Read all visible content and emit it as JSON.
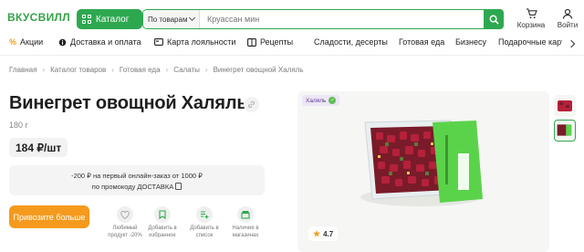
{
  "header": {
    "logo": "ВКУСВИЛЛ",
    "catalog_label": "Каталог",
    "search_scope": "По товарам",
    "search_placeholder": "Круассан мин",
    "cart_label": "Корзина",
    "login_label": "Войти"
  },
  "nav": {
    "items": [
      {
        "label": "Акции",
        "icon": "percent-icon"
      },
      {
        "label": "Доставка и оплата",
        "icon": "info-icon"
      },
      {
        "label": "Карта лояльности",
        "icon": "card-icon"
      },
      {
        "label": "Рецепты",
        "icon": "book-icon"
      },
      {
        "label": "Сладости, десерты"
      },
      {
        "label": "Готовая еда"
      },
      {
        "label": "Бизнесу"
      },
      {
        "label": "Подарочные карт"
      }
    ]
  },
  "breadcrumb": [
    "Главная",
    "Каталог товаров",
    "Готовая еда",
    "Салаты",
    "Винегрет овощной Халяль"
  ],
  "product": {
    "title": "Винегрет овощной Халяль",
    "weight": "180 г",
    "price": "184 ₽/шт",
    "promo_line1": "-200 ₽ на первый онлайн-заказ от 1000 ₽",
    "promo_line2": "по промокоду ДОСТАВКА",
    "buy_label": "Привозите больше",
    "badge": "Халяль",
    "rating": "4.7"
  },
  "actions": [
    {
      "label": "Любимый продукт -20%",
      "icon": "heart-icon"
    },
    {
      "label": "Добавить в избранное",
      "icon": "bookmark-icon"
    },
    {
      "label": "Добавить в список",
      "icon": "list-add-icon"
    },
    {
      "label": "Наличие в магазинах",
      "icon": "store-icon"
    }
  ],
  "colors": {
    "brand_green": "#2ea850",
    "accent_orange": "#f59a1d",
    "halal_purple": "#5c3b8f"
  }
}
